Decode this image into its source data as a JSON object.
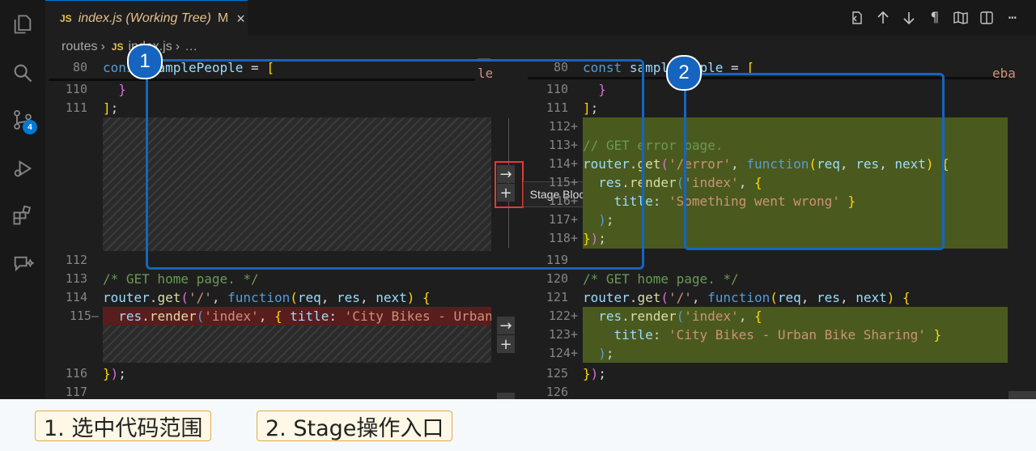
{
  "tab": {
    "badge": "JS",
    "title": "index.js (Working Tree)",
    "status": "M",
    "close": "×"
  },
  "breadcrumb": [
    "routes",
    "JS",
    "index.js",
    "…"
  ],
  "badges": {
    "source_control": "4"
  },
  "toolbar_icons": [
    "open-file-icon",
    "arrow-up-icon",
    "arrow-down-icon",
    "pilcrow-icon",
    "book-icon",
    "split-editor-icon",
    "more-icon"
  ],
  "left_pane": {
    "lines": [
      {
        "num": "80",
        "text": "const samplePeople = ["
      },
      {
        "num": "110",
        "text": "  }"
      },
      {
        "num": "111",
        "text": "];"
      },
      {
        "num": "112",
        "text": ""
      },
      {
        "num": "113",
        "text": "/* GET home page. */"
      },
      {
        "num": "114",
        "text": "router.get('/', function(req, res, next) {"
      },
      {
        "num": "115—",
        "text": "  res.render('index', { title: 'City Bikes - Urban"
      },
      {
        "num": "116",
        "text": "});"
      },
      {
        "num": "117",
        "text": ""
      }
    ],
    "overflow_text": "le"
  },
  "right_pane": {
    "lines": [
      {
        "num": "80",
        "text": "const samplePeople = ["
      },
      {
        "num": "110",
        "text": "  }"
      },
      {
        "num": "111",
        "text": "];"
      },
      {
        "num": "112+",
        "text": ""
      },
      {
        "num": "113+",
        "text": "// GET error page."
      },
      {
        "num": "114+",
        "text": "router.get('/error', function(req, res, next) {"
      },
      {
        "num": "115+",
        "text": "  res.render('index', {"
      },
      {
        "num": "116+",
        "text": "    title: 'Something went wrong' }"
      },
      {
        "num": "117+",
        "text": "  );"
      },
      {
        "num": "118+",
        "text": "});"
      },
      {
        "num": "119",
        "text": ""
      },
      {
        "num": "120",
        "text": "/* GET home page. */"
      },
      {
        "num": "121",
        "text": "router.get('/', function(req, res, next) {"
      },
      {
        "num": "122+",
        "text": "  res.render('index', {"
      },
      {
        "num": "123+",
        "text": "    title: 'City Bikes - Urban Bike Sharing' }"
      },
      {
        "num": "124+",
        "text": "  );"
      },
      {
        "num": "125",
        "text": "});"
      },
      {
        "num": "126",
        "text": ""
      }
    ],
    "overflow_text": "eba"
  },
  "gutter": {
    "arrow": "→",
    "plus": "+"
  },
  "tooltip": "Stage Block",
  "annotations": {
    "marker1": "1",
    "marker2": "2"
  },
  "captions": [
    "1. 选中代码范围",
    "2. Stage操作入口"
  ],
  "colors": {
    "accent": "#0078d4",
    "annotation_blue": "#1565c0",
    "highlight_red": "#e53935",
    "added_bg": "#4a5a1e",
    "removed_bg": "#5a1d1d"
  }
}
